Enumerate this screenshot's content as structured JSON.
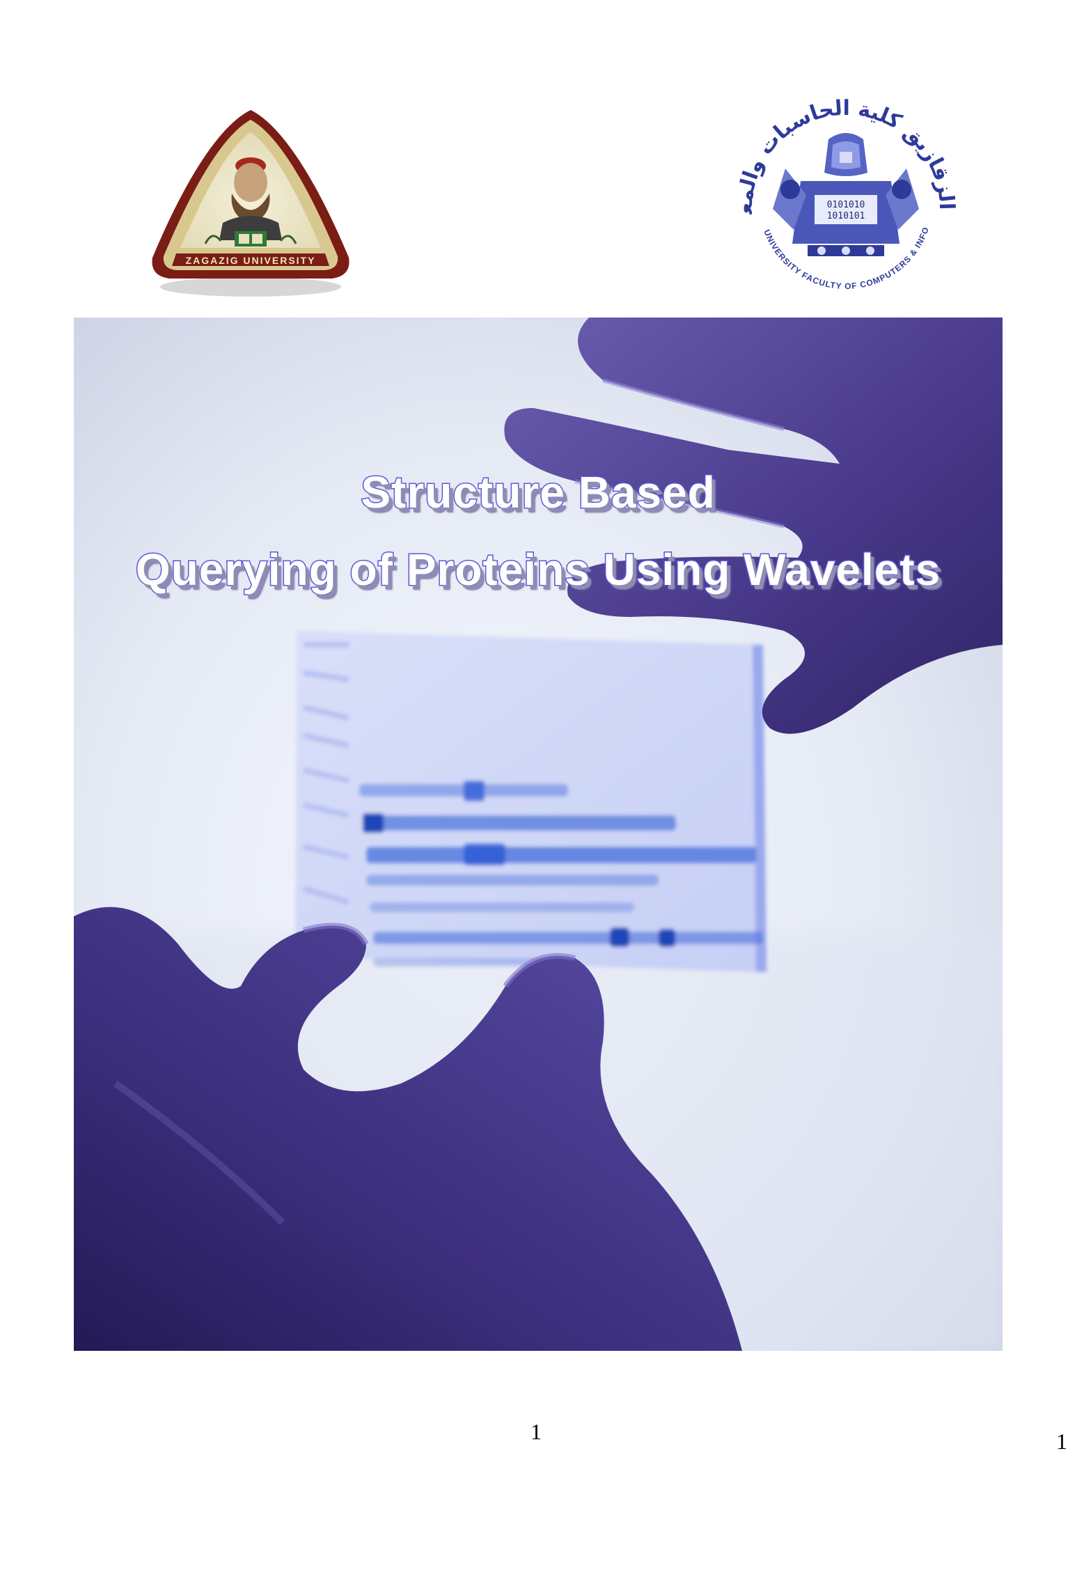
{
  "title": {
    "line1": "Structure Based",
    "line2": "Querying of Proteins Using Wavelets"
  },
  "logos": {
    "left": {
      "name": "zagazig-university-logo",
      "text": "ZAGAZIG UNIVERSITY"
    },
    "right": {
      "name": "faculty-of-computers-and-informatics-logo",
      "text_arabic": "جامعة الزقازيق كلية الحاسبات والمعلومات",
      "text_english": "ZAGAZIG UNIVERSITY FACULTY OF COMPUTERS & INFORMATICS",
      "binary": [
        "0101010",
        "1010101"
      ]
    }
  },
  "page_numbers": {
    "center": "1",
    "corner": "1"
  },
  "colors": {
    "title_outline": "#5a58d8",
    "glove": "#4a3a8c",
    "gel_band": "#2f5fd6"
  }
}
